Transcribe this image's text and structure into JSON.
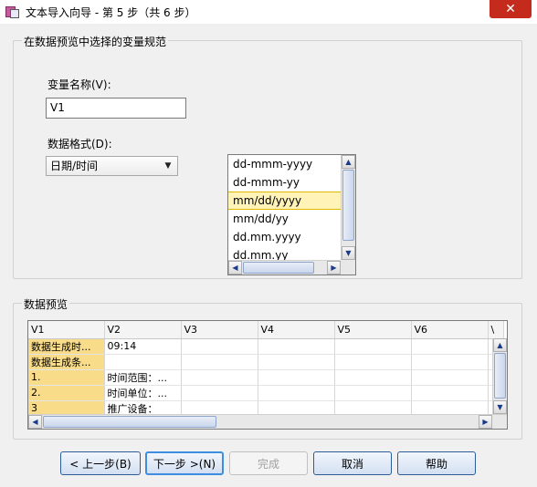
{
  "window": {
    "title": "文本导入向导 - 第 5 步（共 6 步）",
    "close_label": "✕"
  },
  "spec_group": {
    "label": "在数据预览中选择的变量规范",
    "var_name_label": "变量名称(V):",
    "var_name_value": "V1",
    "data_format_label": "数据格式(D):",
    "data_format_value": "日期/时间",
    "format_list": [
      "dd-mmm-yyyy",
      "dd-mmm-yy",
      "mm/dd/yyyy",
      "mm/dd/yy",
      "dd.mm.yyyy",
      "dd.mm.yy"
    ],
    "selected_format": "mm/dd/yyyy"
  },
  "preview_group": {
    "label": "数据预览",
    "columns": [
      "V1",
      "V2",
      "V3",
      "V4",
      "V5",
      "V6",
      "\\"
    ],
    "rows": [
      [
        "数据生成时...",
        "09:14",
        "",
        "",
        "",
        "",
        ""
      ],
      [
        "数据生成条...",
        "",
        "",
        "",
        "",
        "",
        ""
      ],
      [
        "1.",
        "时间范围：...",
        "",
        "",
        "",
        "",
        ""
      ],
      [
        "2.",
        "时间单位：...",
        "",
        "",
        "",
        "",
        ""
      ],
      [
        "3",
        "推广设备：",
        "",
        "",
        "",
        "",
        ""
      ]
    ]
  },
  "buttons": {
    "back": "< 上一步(B)",
    "next": "下一步 >(N)",
    "finish": "完成",
    "cancel": "取消",
    "help": "帮助"
  },
  "colors": {
    "highlight_cell": "#f8dc8a",
    "selected_item": "#fff3b8",
    "close_button": "#c42b1c"
  }
}
